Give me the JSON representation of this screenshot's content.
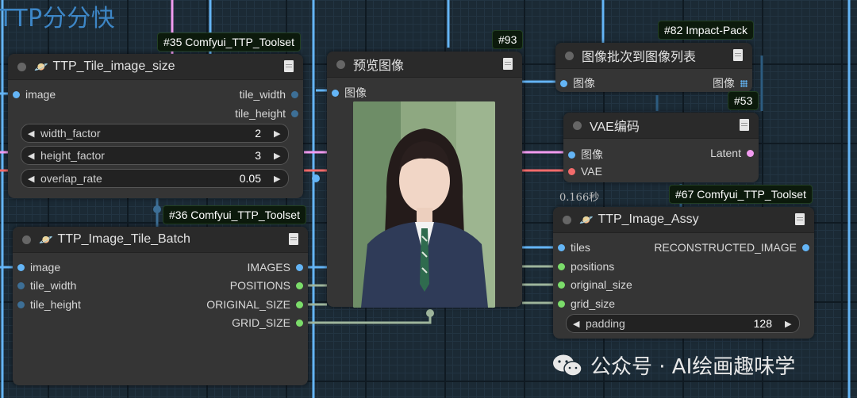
{
  "group_title": "TTP分分快",
  "colors": {
    "canvas": "#1b2a35",
    "image_wire": "#64b5f6",
    "int_wire": "#9eb59c",
    "latent_wire": "#f29bf0",
    "vae_wire": "#f26b6b",
    "node_body": "#353535"
  },
  "timing_label": "0.166秒",
  "watermark": {
    "logo_icon": "wechat-icon",
    "text": "公众号 · AI绘画趣味学"
  },
  "nodes": {
    "tile_size": {
      "badge": "#35 Comfyui_TTP_Toolset",
      "emoji": "🪐",
      "title": "TTP_Tile_image_size",
      "inputs": [
        "image"
      ],
      "outputs": [
        "tile_width",
        "tile_height"
      ],
      "widgets": [
        {
          "name": "width_factor",
          "value": "2"
        },
        {
          "name": "height_factor",
          "value": "3"
        },
        {
          "name": "overlap_rate",
          "value": "0.05"
        }
      ]
    },
    "tile_batch": {
      "badge": "#36 Comfyui_TTP_Toolset",
      "emoji": "🪐",
      "title": "TTP_Image_Tile_Batch",
      "inputs": [
        "image",
        "tile_width",
        "tile_height"
      ],
      "outputs": [
        "IMAGES",
        "POSITIONS",
        "ORIGINAL_SIZE",
        "GRID_SIZE"
      ]
    },
    "preview": {
      "badge": "#93",
      "title": "预览图像",
      "inputs": [
        "图像"
      ]
    },
    "batch_to_list": {
      "badge": "#82 Impact-Pack",
      "title": "图像批次到图像列表",
      "inputs": [
        "图像"
      ],
      "outputs": [
        "图像"
      ]
    },
    "vae_encode": {
      "badge": "#53",
      "title": "VAE编码",
      "inputs": [
        "图像",
        "VAE"
      ],
      "outputs": [
        "Latent"
      ]
    },
    "image_assy": {
      "badge": "#67 Comfyui_TTP_Toolset",
      "emoji": "🪐",
      "title": "TTP_Image_Assy",
      "inputs": [
        "tiles",
        "positions",
        "original_size",
        "grid_size"
      ],
      "outputs": [
        "RECONSTRUCTED_IMAGE"
      ],
      "widgets": [
        {
          "name": "padding",
          "value": "128"
        }
      ]
    }
  }
}
